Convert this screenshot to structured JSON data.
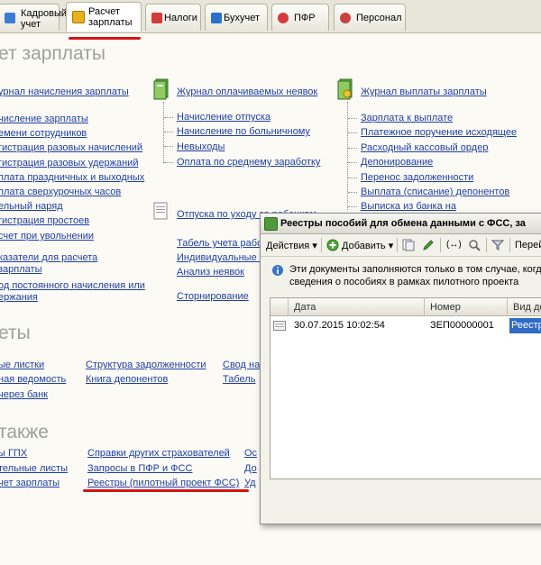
{
  "tabs": [
    {
      "label": "Кадровый учет",
      "color": "#3b7bd6"
    },
    {
      "label": "Расчет зарплаты",
      "color": "#e8b21c",
      "active": true
    },
    {
      "label": "Налоги",
      "color": "#d33b3b"
    },
    {
      "label": "Бухучет",
      "color": "#2b70c9"
    },
    {
      "label": "ПФР",
      "color": "#d43c3c"
    },
    {
      "label": "Персонал",
      "color": "#c84040"
    }
  ],
  "page": {
    "title": "ет зарплаты"
  },
  "col1": {
    "links": [
      "урнал начисления зарплаты",
      "числение зарплаты",
      "емени сотрудников",
      "гистрация разовых начислений",
      "гистрация разовых удержаний",
      "плата праздничных и выходных",
      "плата сверхурочных часов",
      "ельный наряд",
      "гистрация простоев",
      "счет при увольнении",
      "казатели для расчета",
      "зарплаты",
      "од постоянного начисления или",
      "ержания"
    ]
  },
  "col2": {
    "head": "Журнал оплачиваемых неявок",
    "items": [
      "Начисление отпуска",
      "Начисление по больничному",
      "Невыходы",
      "Оплата по среднему заработку"
    ],
    "leave": "Отпуска по уходу за ребенком",
    "more": [
      "Табель учета рабо",
      "Индивидуальные г",
      "Анализ неявок",
      "Сторнирование"
    ]
  },
  "col3": {
    "head": "Журнал выплаты зарплаты",
    "items": [
      "Зарплата к выплате",
      "Платежное поручение исходящее",
      "Расходный кассовый ордер",
      "Депонирование",
      "Перенос задолженности",
      "Выплата (списание) депонентов",
      "Выписка из банка на"
    ]
  },
  "reports": {
    "title": "еты",
    "col1": [
      "ые листки",
      "ная ведомость",
      "через банк"
    ],
    "col2": [
      "Структура задолженности",
      "Книга депонентов"
    ],
    "col3": [
      "Свод на",
      "Табель"
    ]
  },
  "also": {
    "title": "также",
    "col1": [
      "ы ГПХ",
      "тельные листы",
      "чет зарплаты"
    ],
    "col2": [
      "Справки других страхователей",
      "Запросы в ПФР и ФСС",
      "Реестры (пилотный проект ФСС)"
    ],
    "col3": [
      "Ос",
      "До",
      "Уд"
    ]
  },
  "window": {
    "title": "Реестры пособий для обмена данными с ФСС, за",
    "toolbar": {
      "actions": "Действия",
      "add": "Добавить",
      "go": "Перей"
    },
    "info_line1": "Эти документы заполняются только в том случае, когда",
    "info_line2": "сведения о пособиях в рамках пилотного проекта",
    "columns": [
      "Дата",
      "Номер",
      "Вид до"
    ],
    "rows": [
      {
        "date": "30.07.2015 10:02:54",
        "number": "ЗЕП00000001",
        "kind": "Реестр"
      }
    ]
  }
}
